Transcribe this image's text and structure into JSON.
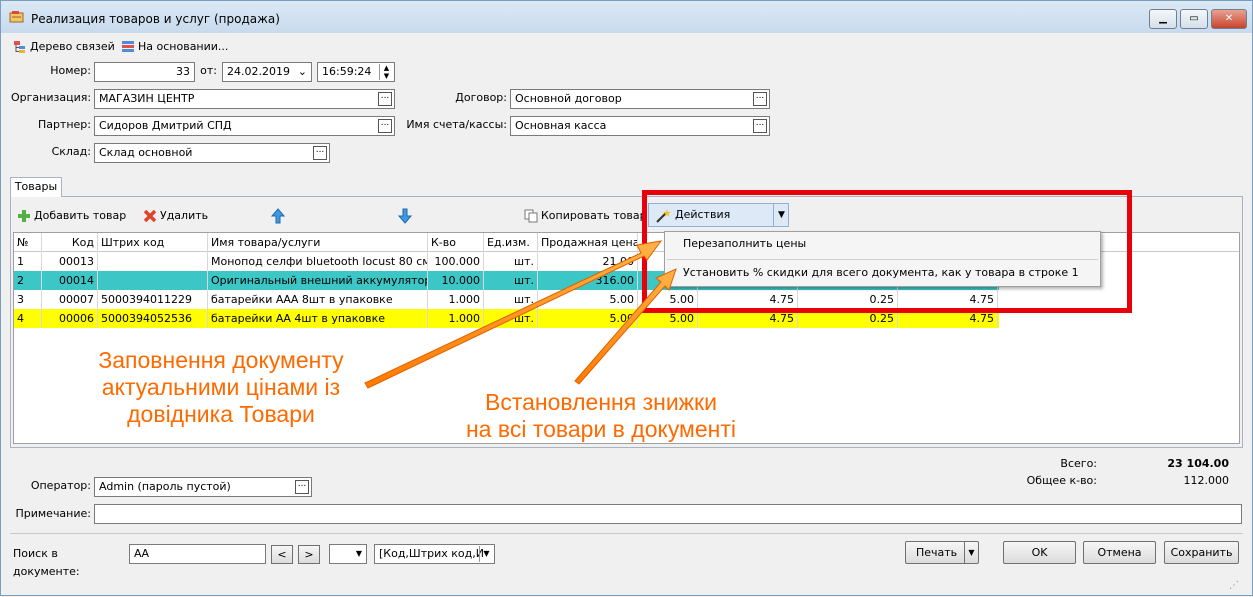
{
  "window": {
    "title": "Реализация товаров и услуг (продажа)"
  },
  "toolbar": {
    "links_tree": "Дерево связей",
    "based_on": "На основании..."
  },
  "header": {
    "number_label": "Номер:",
    "number_value": "33",
    "from_label": "от:",
    "date_value": "24.02.2019",
    "time_value": "16:59:24",
    "org_label": "Организация:",
    "org_value": "МАГАЗИН ЦЕНТР",
    "partner_label": "Партнер:",
    "partner_value": "Сидоров Дмитрий СПД",
    "warehouse_label": "Склад:",
    "warehouse_value": "Склад основной",
    "contract_label": "Договор:",
    "contract_value": "Основной договор",
    "account_label": "Имя счета/кассы:",
    "account_value": "Основная касса"
  },
  "tabs": {
    "goods": "Товары"
  },
  "goods_toolbar": {
    "add": "Добавить товар",
    "delete": "Удалить",
    "copy": "Копировать товар",
    "actions": "Действия"
  },
  "table": {
    "headers": [
      "№",
      "Код",
      "Штрих код",
      "Имя товара/услуги",
      "К-во",
      "Ед.изм.",
      "Продажная цена"
    ],
    "rows": [
      {
        "n": "1",
        "code": "00013",
        "barcode": "",
        "name": "Монопод селфи bluetooth locust 80 см",
        "qty": "100.000",
        "unit": "шт.",
        "price": "21.00",
        "c8": "",
        "c9": "",
        "c10": "",
        "c11": ""
      },
      {
        "n": "2",
        "code": "00014",
        "barcode": "",
        "name": "Оригинальный внешний аккумулятор xi...",
        "qty": "10.000",
        "unit": "шт.",
        "price": "316.00",
        "c8": "",
        "c9": "",
        "c10": "",
        "c11": ""
      },
      {
        "n": "3",
        "code": "00007",
        "barcode": "5000394011229",
        "name": "батарейки ААА 8шт в упаковке",
        "qty": "1.000",
        "unit": "шт.",
        "price": "5.00",
        "c8": "5.00",
        "c9": "4.75",
        "c10": "0.25",
        "c11": "4.75"
      },
      {
        "n": "4",
        "code": "00006",
        "barcode": "5000394052536",
        "name": "батарейки АА 4шт в упаковке",
        "qty": "1.000",
        "unit": "шт.",
        "price": "5.00",
        "c8": "5.00",
        "c9": "4.75",
        "c10": "0.25",
        "c11": "4.75"
      }
    ]
  },
  "menu": {
    "item1": "Перезаполнить цены",
    "item2": "Установить % скидки для всего документа, как у товара в строке 1"
  },
  "annotations": {
    "left_line1": "Заповнення документу",
    "left_line2": "актуальними цінами із",
    "left_line3": "довідника Товари",
    "right_line1": "Встановлення знижки",
    "right_line2": "на всі товари в документі"
  },
  "footer": {
    "total_label": "Всего:",
    "total_value": "23 104.00",
    "count_label": "Общее к-во:",
    "count_value": "112.000",
    "operator_label": "Оператор:",
    "operator_value": "Admin (пароль пустой)",
    "note_label": "Примечание:",
    "note_value": "",
    "search_label": "Поиск в документе:",
    "search_value": "АА",
    "prev": "<",
    "next": ">",
    "search_fields": "[Код,Штрих код,И",
    "print": "Печать",
    "ok": "OK",
    "cancel": "Отмена",
    "save": "Сохранить"
  },
  "colors": {
    "selected_row": "#3cc6c6",
    "highlight_row": "#ffff00",
    "callout": "#ff6a00",
    "red_frame": "#e8000b"
  }
}
